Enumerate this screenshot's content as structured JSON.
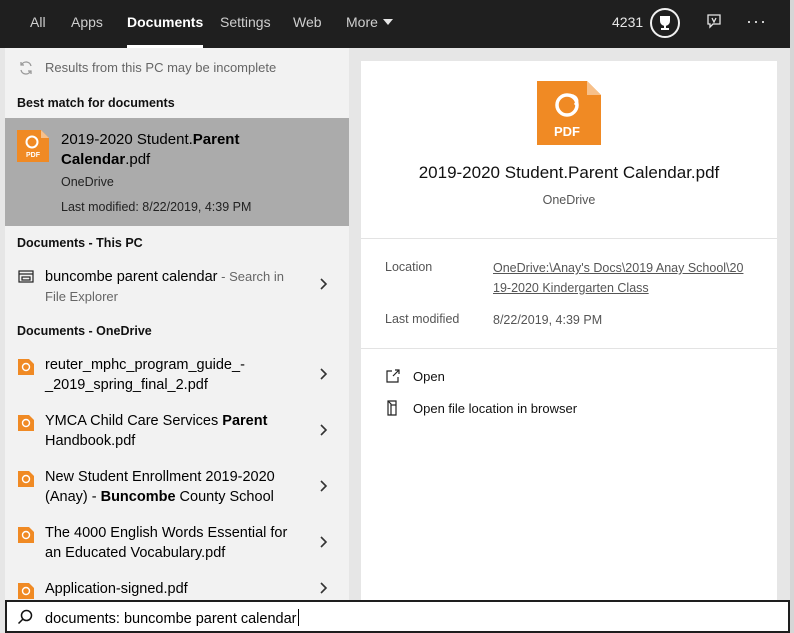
{
  "tabs": [
    {
      "label": "All"
    },
    {
      "label": "Apps"
    },
    {
      "label": "Documents"
    },
    {
      "label": "Settings"
    },
    {
      "label": "Web"
    },
    {
      "label": "More"
    }
  ],
  "header": {
    "points": "4231",
    "trophy_icon": "trophy-icon",
    "feedback_icon": "feedback-icon",
    "more_icon": "ellipsis-icon",
    "more_dots": "···"
  },
  "notice": "Results from this PC may be incomplete",
  "best_match": {
    "heading": "Best match for documents",
    "name_normal": "2019-2020 Student.",
    "name_bold": "Parent",
    "name_line2": "Calendar",
    "name_ext": ".pdf",
    "location": "OneDrive",
    "modified": "Last modified: 8/22/2019, 4:39 PM"
  },
  "this_pc": {
    "heading": "Documents - This PC",
    "item": {
      "label": "buncombe parent calendar",
      "hint": " - Search in",
      "hint2": "File Explorer"
    }
  },
  "onedrive": {
    "heading": "Documents - OneDrive",
    "items": [
      {
        "line1": "reuter_mphc_program_guide_-",
        "line2": "_2019_spring_final_2.pdf"
      },
      {
        "line1_a": "YMCA Child Care Services ",
        "line1_b": "Parent",
        "line2": "Handbook.pdf"
      },
      {
        "line1": "New Student Enrollment 2019-2020",
        "line2_a": "(Anay) - ",
        "line2_b": "Buncombe",
        "line2_c": " County School"
      },
      {
        "line1": "The 4000 English Words Essential for",
        "line2": "an Educated Vocabulary.pdf"
      },
      {
        "line1": "Application-signed.pdf"
      }
    ]
  },
  "preview": {
    "icon_text": "PDF",
    "title": "2019-2020 Student.Parent Calendar.pdf",
    "subtitle": "OneDrive",
    "location_label": "Location",
    "location_value_line1": "OneDrive:\\Anay's Docs\\2019 Anay School\\20",
    "location_value_line2": "19-2020 Kindergarten Class",
    "modified_label": "Last modified",
    "modified_value": "8/22/2019, 4:39 PM",
    "actions": [
      {
        "label": "Open",
        "icon": "open-icon"
      },
      {
        "label": "Open file location in browser",
        "icon": "file-location-icon"
      }
    ]
  },
  "search": {
    "value": "documents: buncombe parent calendar",
    "icon": "search-icon"
  },
  "colors": {
    "accent_orange": "#f08a24",
    "selected_bg": "#ababab",
    "topbar_bg": "#1f1f1f"
  }
}
